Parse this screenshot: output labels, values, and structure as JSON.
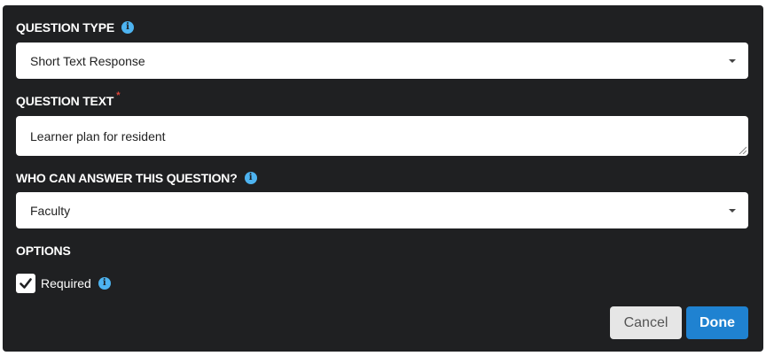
{
  "question_type": {
    "label": "QUESTION TYPE",
    "value": "Short Text Response"
  },
  "question_text": {
    "label": "QUESTION TEXT",
    "required_marker": "*",
    "value": "Learner plan for resident"
  },
  "who_can_answer": {
    "label": "WHO CAN ANSWER THIS QUESTION?",
    "value": "Faculty"
  },
  "options": {
    "label": "OPTIONS",
    "required_label": "Required",
    "required_checked": true
  },
  "actions": {
    "cancel_label": "Cancel",
    "done_label": "Done"
  },
  "colors": {
    "panel_bg": "#1f2022",
    "info_icon": "#4db3f0",
    "required_star": "#e0463a",
    "done_button": "#1f82d1",
    "cancel_button": "#e6e6e6"
  }
}
